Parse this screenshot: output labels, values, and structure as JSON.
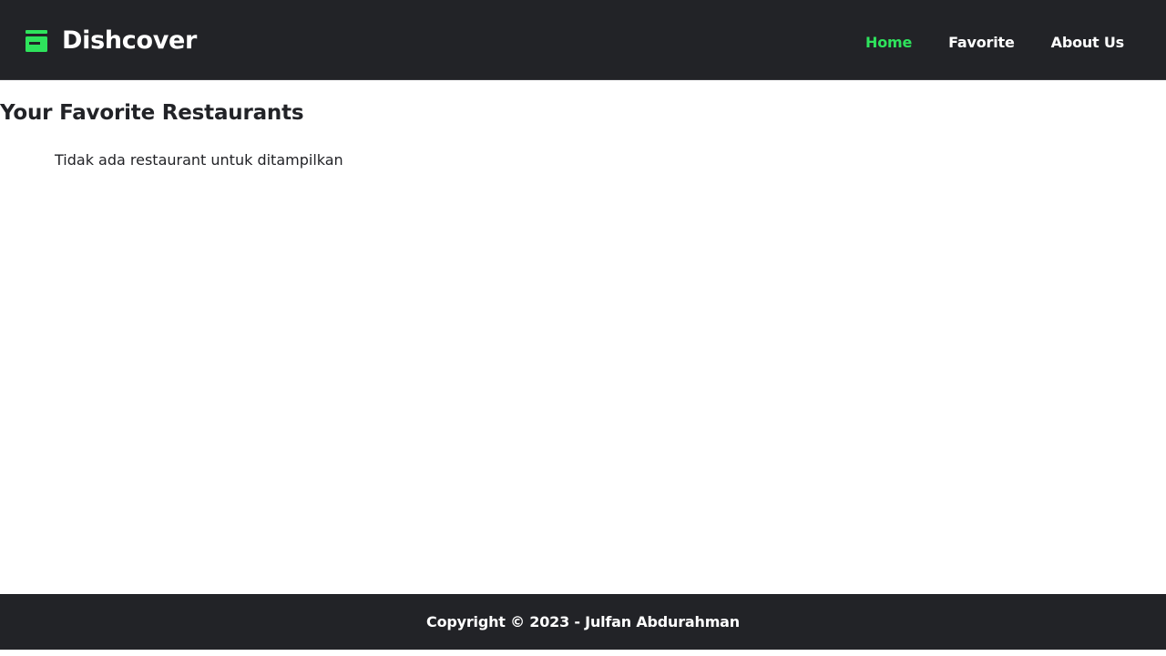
{
  "header": {
    "brand_name": "Dishcover",
    "brand_icon": "store-icon",
    "accent_color": "#2ee35c",
    "background_color": "#222327"
  },
  "nav": {
    "items": [
      {
        "label": "Home",
        "active": true
      },
      {
        "label": "Favorite",
        "active": false
      },
      {
        "label": "About Us",
        "active": false
      }
    ]
  },
  "main": {
    "title": "Your Favorite Restaurants",
    "empty_message": "Tidak ada restaurant untuk ditampilkan"
  },
  "footer": {
    "copyright": "Copyright © 2023 - Julfan Abdurahman"
  }
}
